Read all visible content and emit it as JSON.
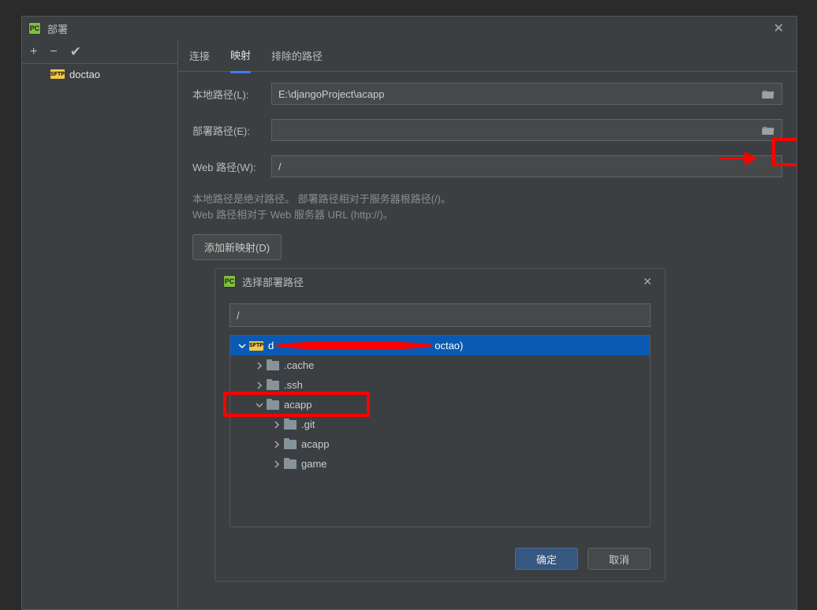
{
  "window": {
    "title": "部署"
  },
  "sidebar": {
    "items": [
      {
        "name": "doctao"
      }
    ]
  },
  "tabs": {
    "connect": "连接",
    "mapping": "映射",
    "excluded": "排除的路径"
  },
  "form": {
    "local_label": "本地路径(L):",
    "local_value": "E:\\djangoProject\\acapp",
    "deploy_label": "部署路径(E):",
    "deploy_value": "",
    "web_label": "Web 路径(W):",
    "web_value": "/",
    "info_line1": "本地路径是绝对路径。 部署路径相对于服务器根路径(/)。",
    "info_line2": "Web 路径相对于 Web 服务器 URL (http://)。",
    "add_button": "添加新映射(D)"
  },
  "dialog": {
    "title": "选择部署路径",
    "path_value": "/",
    "ok": "确定",
    "cancel": "取消",
    "root_suffix": "octao)",
    "tree": [
      {
        "indent": 0,
        "expanded": true,
        "name": "d",
        "selected": true,
        "is_sftp": true
      },
      {
        "indent": 1,
        "expanded": false,
        "name": ".cache"
      },
      {
        "indent": 1,
        "expanded": false,
        "name": ".ssh"
      },
      {
        "indent": 1,
        "expanded": true,
        "name": "acapp"
      },
      {
        "indent": 2,
        "expanded": false,
        "name": ".git"
      },
      {
        "indent": 2,
        "expanded": false,
        "name": "acapp"
      },
      {
        "indent": 2,
        "expanded": false,
        "name": "game"
      }
    ]
  }
}
